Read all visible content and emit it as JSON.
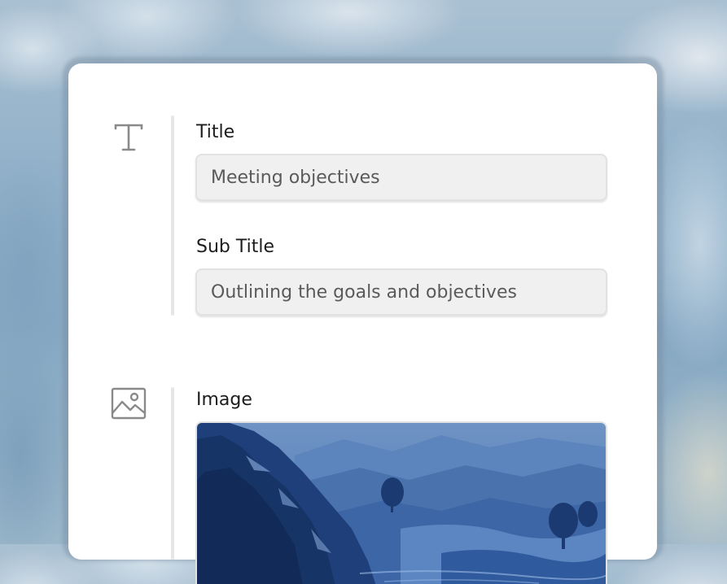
{
  "form": {
    "text_section": {
      "icon": "text-type-icon",
      "title_field": {
        "label": "Title",
        "value": "Meeting objectives"
      },
      "subtitle_field": {
        "label": "Sub Title",
        "value": "Outlining the goals and objectives"
      }
    },
    "image_section": {
      "icon": "image-icon",
      "label": "Image",
      "image_description": "blue-painted-mountain-landscape"
    }
  },
  "colors": {
    "card_background": "#ffffff",
    "input_background": "#f0f0f0",
    "icon_gray": "#8a8a8a",
    "image_primary_blue": "#2f5a9e"
  }
}
